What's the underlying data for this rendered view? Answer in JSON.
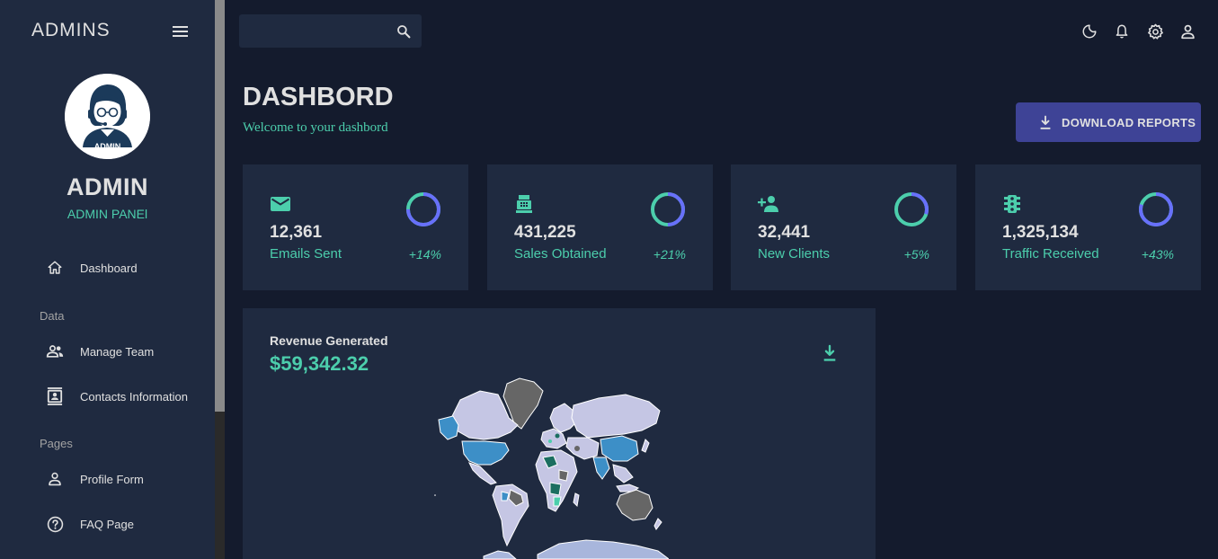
{
  "sidebar": {
    "brand": "ADMINS",
    "avatar_label": "ADMIN",
    "user_name": "ADMIN",
    "user_role": "ADMIN PANEl",
    "items": [
      {
        "label": "Dashboard",
        "icon": "home-icon"
      },
      {
        "label": "Manage Team",
        "icon": "people-icon"
      },
      {
        "label": "Contacts Information",
        "icon": "contacts-icon"
      },
      {
        "label": "Profile Form",
        "icon": "person-icon"
      },
      {
        "label": "FAQ Page",
        "icon": "help-icon"
      }
    ],
    "sections": [
      "Data",
      "Pages"
    ]
  },
  "topbar": {
    "search_placeholder": "",
    "icons": [
      "dark-mode-icon",
      "notifications-icon",
      "settings-icon",
      "account-icon"
    ]
  },
  "header": {
    "title": "DASHBORD",
    "subtitle": "Welcome to your dashbord",
    "download_label": "DOWNLOAD REPORTS"
  },
  "stats": [
    {
      "value": "12,361",
      "label": "Emails Sent",
      "increase": "+14%",
      "progress": 0.75,
      "icon": "email-icon"
    },
    {
      "value": "431,225",
      "label": "Sales Obtained",
      "increase": "+21%",
      "progress": 0.5,
      "icon": "point-of-sale-icon"
    },
    {
      "value": "32,441",
      "label": "New Clients",
      "increase": "+5%",
      "progress": 0.3,
      "icon": "person-add-icon"
    },
    {
      "value": "1,325,134",
      "label": "Traffic Received",
      "increase": "+43%",
      "progress": 0.8,
      "icon": "traffic-icon"
    }
  ],
  "revenue": {
    "title": "Revenue Generated",
    "value": "$59,342.32"
  },
  "colors": {
    "background": "#141b2d",
    "panel": "#1f2a40",
    "accent_green": "#4cceac",
    "button": "#3e4396",
    "ring_blue": "#6870fa"
  }
}
